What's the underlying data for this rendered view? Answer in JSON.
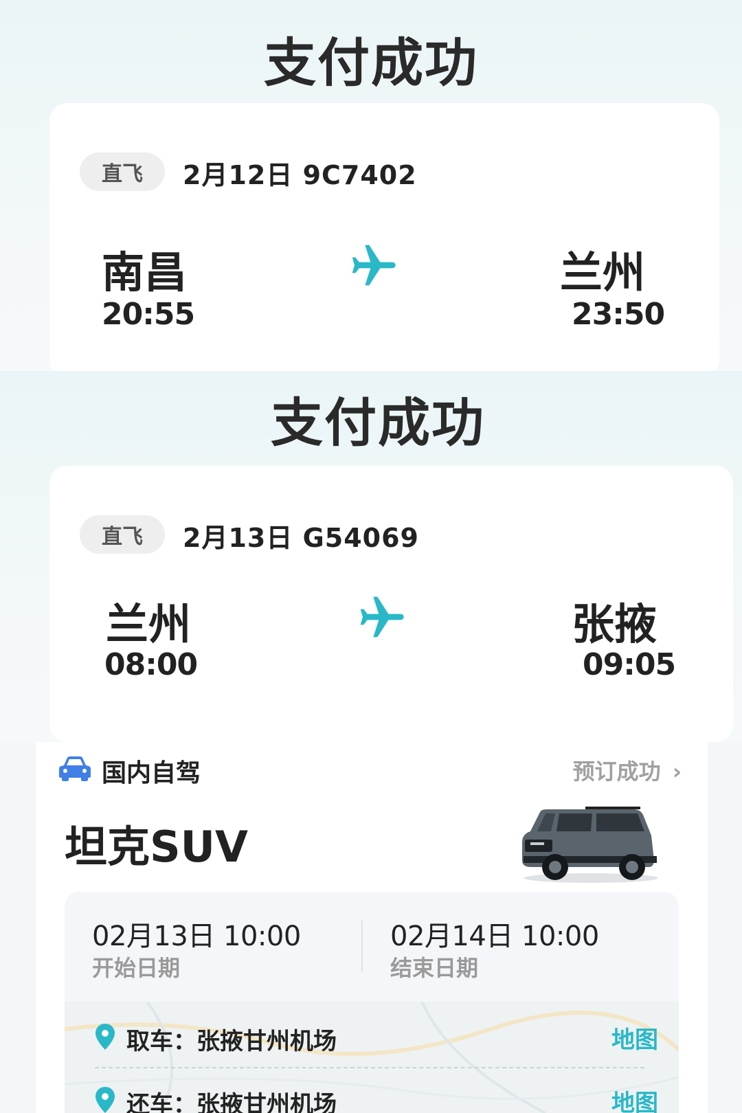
{
  "colors": {
    "accent": "#29b8c7",
    "car_icon": "#3f7fe6",
    "text": "#222222",
    "muted": "#9a9a9a",
    "tag_bg": "#eeeeee"
  },
  "flights": [
    {
      "status_title": "支付成功",
      "tag": "直飞",
      "date": "2月12日",
      "flight_no": "9C7402",
      "depart_city": "南昌",
      "depart_time": "20:55",
      "arrive_city": "兰州",
      "arrive_time": "23:50",
      "icon": "airplane-icon"
    },
    {
      "status_title": "支付成功",
      "tag": "直飞",
      "date": "2月13日",
      "flight_no": "G54069",
      "depart_city": "兰州",
      "depart_time": "08:00",
      "arrive_city": "张掖",
      "arrive_time": "09:05",
      "icon": "airplane-icon"
    }
  ],
  "rental": {
    "section_icon": "car-icon",
    "section_title": "国内自驾",
    "status": "预订成功",
    "status_chevron": "›",
    "car_name": "坦克SUV",
    "car_image": "suv-car-photo",
    "start_datetime": "02月13日 10:00",
    "start_label": "开始日期",
    "end_datetime": "02月14日 10:00",
    "end_label": "结束日期",
    "pickup": {
      "text": "取车：张掖甘州机场",
      "map_label": "地图",
      "icon": "location-pin-icon"
    },
    "return": {
      "text": "还车：张掖甘州机场",
      "map_label": "地图",
      "icon": "location-pin-icon"
    }
  }
}
